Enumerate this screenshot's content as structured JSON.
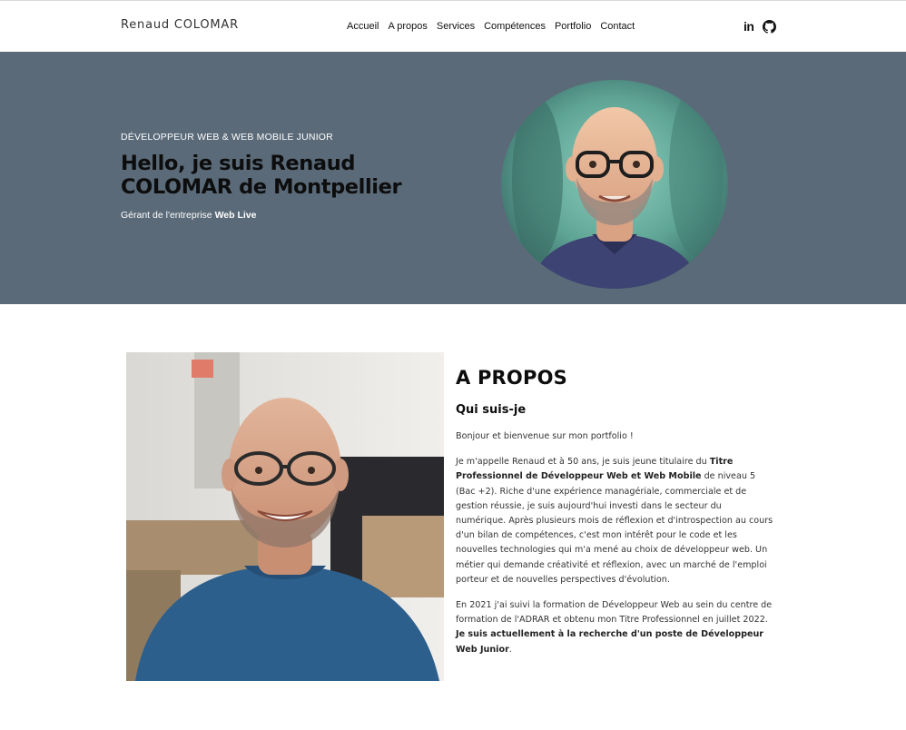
{
  "brand": "Renaud COLOMAR",
  "nav": [
    "Accueil",
    "A propos",
    "Services",
    "Compétences",
    "Portfolio",
    "Contact"
  ],
  "social": {
    "linkedin": "in",
    "github_icon": "github-icon"
  },
  "colors": {
    "hero_bg": "#5a6a78",
    "text_dark": "#0d0d0d"
  },
  "hero": {
    "kicker": "DÉVELOPPEUR WEB & WEB MOBILE JUNIOR",
    "title_line1": "Hello, je suis Renaud",
    "title_line2": "COLOMAR de Montpellier",
    "subtitle_prefix": "Gérant de l'entreprise ",
    "subtitle_company": "Web Live"
  },
  "about": {
    "title": "A PROPOS",
    "subtitle": "Qui suis-je",
    "p1": "Bonjour et bienvenue sur mon portfolio !",
    "p2_a": "Je m'appelle Renaud et à 50 ans, je suis jeune titulaire du ",
    "p2_b": "Titre Professionnel de Développeur Web et Web Mobile",
    "p2_c": " de niveau 5 (Bac +2). Riche d'une expérience managériale, commerciale et de gestion réussie, je suis aujourd'hui investi dans le secteur du numérique. Après plusieurs mois de réflexion et d'introspection au cours d'un bilan de compétences, c'est mon intérêt pour le code et les nouvelles technologies qui m'a mené au choix de développeur web. Un métier qui demande créativité et réflexion, avec un marché de l'emploi porteur et de nouvelles perspectives d'évolution.",
    "p3_a": "En 2021 j'ai suivi la formation de Développeur Web au sein du centre de formation de l'ADRAR et obtenu mon Titre Professionnel en juillet 2022. ",
    "p3_b": "Je suis actuellement à la recherche d'un poste de Développeur Web Junior",
    "p3_c": "."
  }
}
